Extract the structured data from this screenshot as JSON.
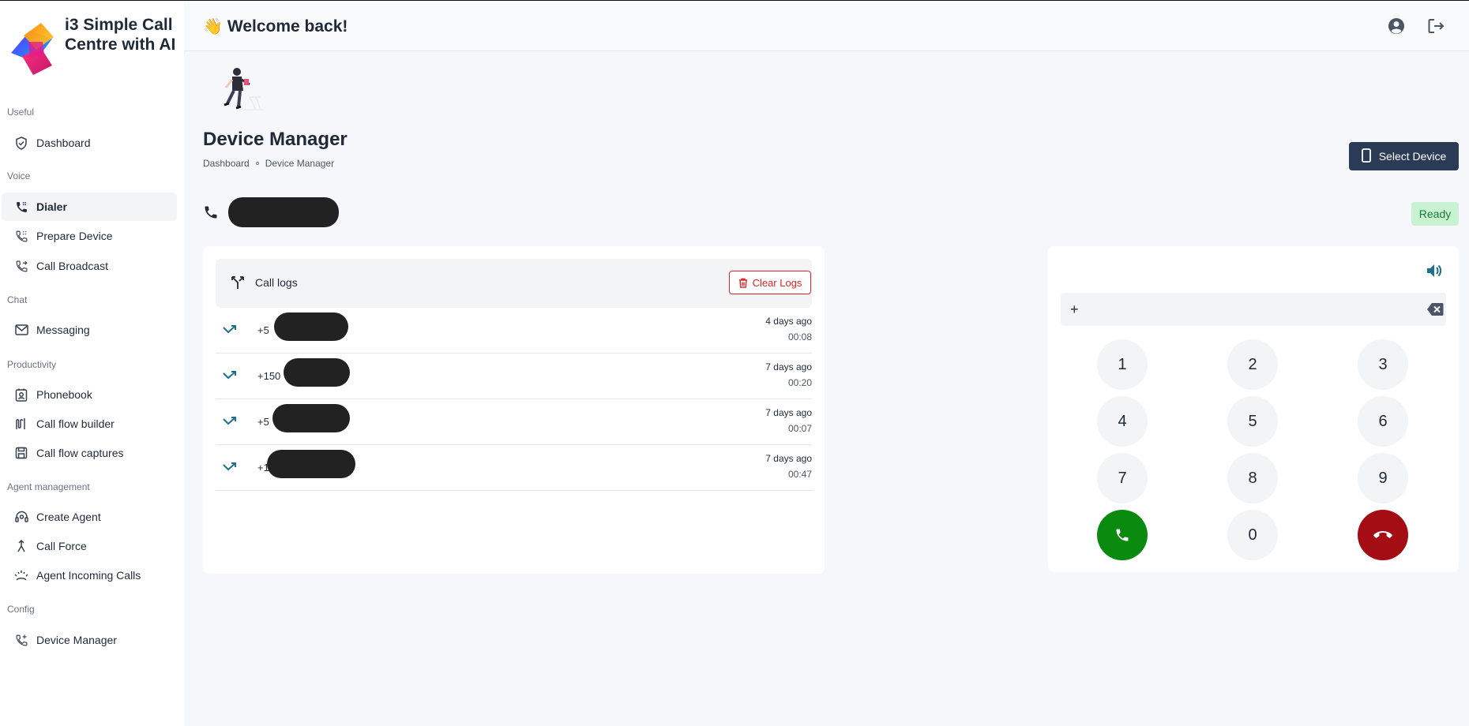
{
  "brand": {
    "name": "i3 Simple Call Centre with AI"
  },
  "header": {
    "wave": "👋",
    "welcome": "Welcome back!"
  },
  "sidebar": {
    "sections": [
      {
        "label": "Useful",
        "items": [
          {
            "label": "Dashboard",
            "icon": "shield-check-icon"
          }
        ]
      },
      {
        "label": "Voice",
        "items": [
          {
            "label": "Dialer",
            "icon": "phone-dialer-icon",
            "active": true
          },
          {
            "label": "Prepare Device",
            "icon": "phone-keypad-icon"
          },
          {
            "label": "Call Broadcast",
            "icon": "phone-forward-icon"
          }
        ]
      },
      {
        "label": "Chat",
        "items": [
          {
            "label": "Messaging",
            "icon": "mail-icon"
          }
        ]
      },
      {
        "label": "Productivity",
        "items": [
          {
            "label": "Phonebook",
            "icon": "contact-book-icon"
          },
          {
            "label": "Call flow builder",
            "icon": "flow-icon"
          },
          {
            "label": "Call flow captures",
            "icon": "save-icon"
          }
        ]
      },
      {
        "label": "Agent management",
        "items": [
          {
            "label": "Create Agent",
            "icon": "headset-icon"
          },
          {
            "label": "Call Force",
            "icon": "force-icon"
          },
          {
            "label": "Agent Incoming Calls",
            "icon": "incoming-signal-icon"
          }
        ]
      },
      {
        "label": "Config",
        "items": [
          {
            "label": "Device Manager",
            "icon": "phone-plus-icon"
          }
        ]
      }
    ]
  },
  "page": {
    "title": "Device Manager",
    "breadcrumb": [
      "Dashboard",
      "Device Manager"
    ],
    "select_device": "Select Device",
    "status": "Ready"
  },
  "call_logs": {
    "title": "Call logs",
    "clear_label": "Clear Logs",
    "rows": [
      {
        "number_prefix": "+5",
        "when": "4 days ago",
        "duration": "00:08"
      },
      {
        "number_prefix": "+150",
        "when": "7 days ago",
        "duration": "00:20"
      },
      {
        "number_prefix": "+5",
        "when": "7 days ago",
        "duration": "00:07"
      },
      {
        "number_prefix": "+1",
        "when": "7 days ago",
        "duration": "00:47"
      }
    ]
  },
  "dialer": {
    "input_value": "+",
    "keys": [
      "1",
      "2",
      "3",
      "4",
      "5",
      "6",
      "7",
      "8",
      "9",
      "0"
    ]
  },
  "colors": {
    "call": "#0a8a0f",
    "hangup": "#a50d14",
    "accent": "#2b3a55",
    "ready_bg": "#c9f2d2"
  }
}
